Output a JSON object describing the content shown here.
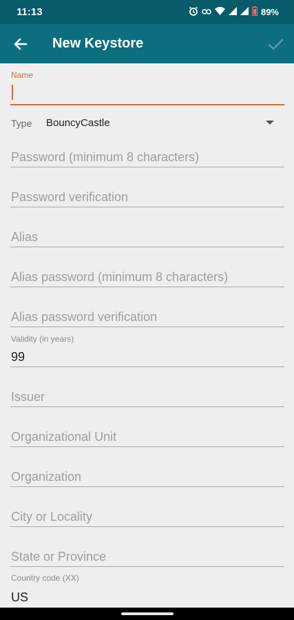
{
  "status_bar": {
    "time": "11:13",
    "battery": "89%",
    "icons": [
      "alarm-icon",
      "link-icon",
      "wifi-icon",
      "signal-icon",
      "signal-icon",
      "battery-icon"
    ]
  },
  "app_bar": {
    "title": "New Keystore",
    "back_icon": "arrow-back-icon",
    "confirm_icon": "check-icon"
  },
  "form": {
    "name": {
      "label": "Name",
      "value": ""
    },
    "type": {
      "label": "Type",
      "value": "BouncyCastle"
    },
    "password": {
      "placeholder": "Password (minimum 8 characters)"
    },
    "password_verification": {
      "placeholder": "Password verification"
    },
    "alias": {
      "placeholder": "Alias"
    },
    "alias_password": {
      "placeholder": "Alias password (minimum 8 characters)"
    },
    "alias_password_verification": {
      "placeholder": "Alias password verification"
    },
    "validity": {
      "label": "Validity (in years)",
      "value": "99"
    },
    "issuer": {
      "placeholder": "Issuer"
    },
    "organizational_unit": {
      "placeholder": "Organizational Unit"
    },
    "organization": {
      "placeholder": "Organization"
    },
    "city": {
      "placeholder": "City or Locality"
    },
    "state": {
      "placeholder": "State or Province"
    },
    "country": {
      "label": "Country code (XX)",
      "value": "US"
    }
  },
  "colors": {
    "status_bar": "#075b6b",
    "app_bar": "#0d6e80",
    "accent": "#d9683c",
    "background": "#eeeeee"
  }
}
